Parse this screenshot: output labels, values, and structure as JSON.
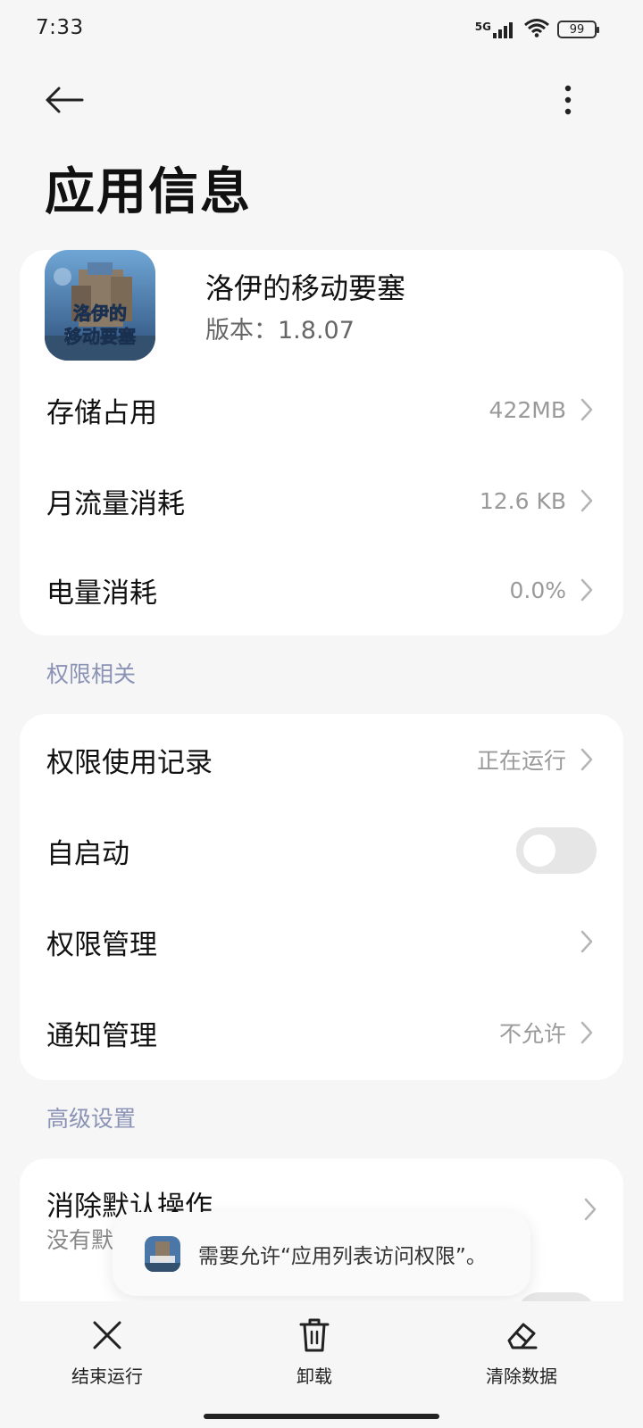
{
  "status_bar": {
    "time": "7:33",
    "network": "5G",
    "battery": "99"
  },
  "header": {
    "title": "应用信息",
    "back_icon": "back-arrow-icon",
    "more_icon": "more-vertical-icon"
  },
  "app": {
    "name": "洛伊的移动要塞",
    "version": "版本：1.8.07",
    "icon_text": "洛伊的移动要塞"
  },
  "usage_rows": [
    {
      "label": "存储占用",
      "value": "422MB"
    },
    {
      "label": "月流量消耗",
      "value": "12.6 KB"
    },
    {
      "label": "电量消耗",
      "value": "0.0%"
    }
  ],
  "permissions_section": {
    "title": "权限相关",
    "rows": [
      {
        "label": "权限使用记录",
        "value": "正在运行"
      },
      {
        "label": "自启动",
        "toggle_on": false
      },
      {
        "label": "权限管理",
        "value": ""
      },
      {
        "label": "通知管理",
        "value": "不允许"
      }
    ]
  },
  "advanced_section": {
    "title": "高级设置",
    "rows": [
      {
        "label": "消除默认操作",
        "sub": "没有默"
      }
    ]
  },
  "toast": {
    "text": "需要允许“应用列表访问权限”。"
  },
  "bottom_actions": [
    {
      "label": "结束运行",
      "icon": "close-icon"
    },
    {
      "label": "卸载",
      "icon": "trash-icon"
    },
    {
      "label": "清除数据",
      "icon": "eraser-icon"
    }
  ],
  "colors": {
    "background": "#f6f6f6",
    "card": "#ffffff",
    "section_title": "#8a93b5",
    "secondary_text": "#9a9a9a"
  }
}
